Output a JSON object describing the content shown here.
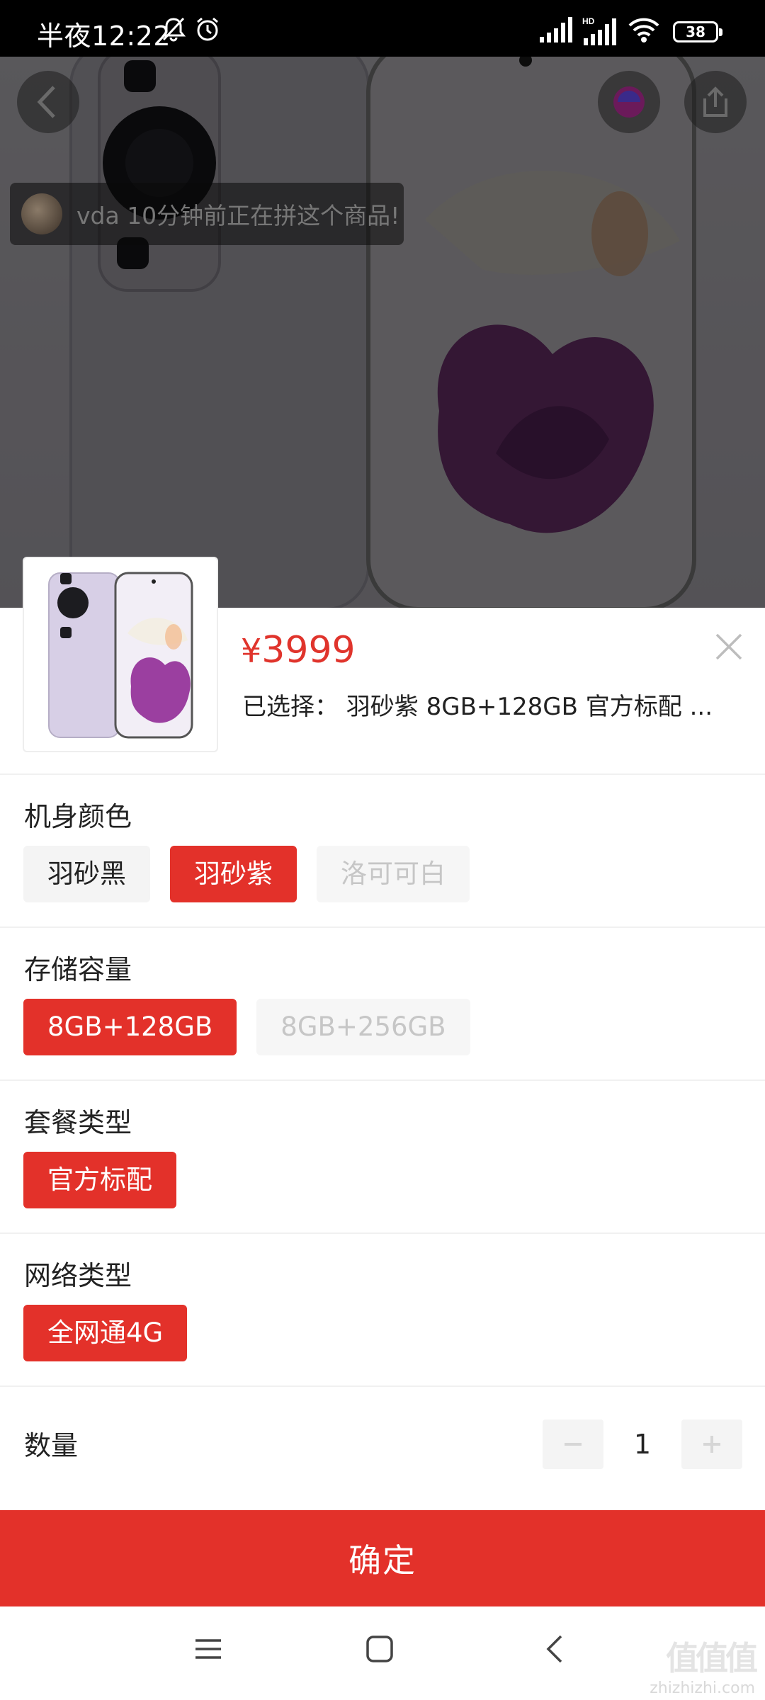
{
  "status_bar": {
    "time": "半夜12:22",
    "battery": "38"
  },
  "toast": {
    "text": "vda 10分钟前正在拼这个商品!"
  },
  "sheet": {
    "price_symbol": "¥",
    "price_value": "3999",
    "selected_text": "已选择： 羽砂紫 8GB+128GB 官方标配 ..."
  },
  "groups": [
    {
      "title": "机身颜色",
      "options": [
        {
          "label": "羽砂黑",
          "state": "normal"
        },
        {
          "label": "羽砂紫",
          "state": "selected"
        },
        {
          "label": "洛可可白",
          "state": "disabled"
        }
      ]
    },
    {
      "title": "存储容量",
      "options": [
        {
          "label": "8GB+128GB",
          "state": "selected"
        },
        {
          "label": "8GB+256GB",
          "state": "disabled"
        }
      ]
    },
    {
      "title": "套餐类型",
      "options": [
        {
          "label": "官方标配",
          "state": "selected"
        }
      ]
    },
    {
      "title": "网络类型",
      "options": [
        {
          "label": "全网通4G",
          "state": "selected"
        }
      ]
    }
  ],
  "quantity": {
    "label": "数量",
    "value": "1"
  },
  "confirm_label": "确定",
  "watermark": {
    "logo": "值值值",
    "site": "zhizhizhi.com"
  },
  "colors": {
    "accent": "#e3312a",
    "price": "#e0342c",
    "disabled_text": "#c6c6c6"
  }
}
